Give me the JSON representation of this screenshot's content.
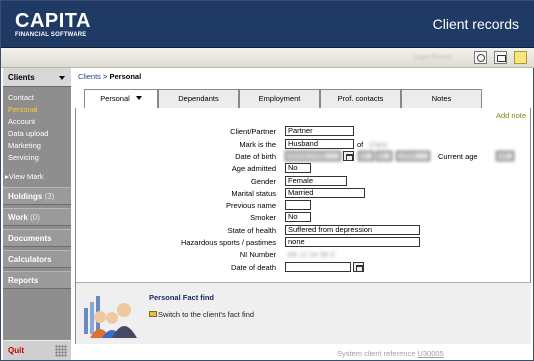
{
  "brand": {
    "name": "CAPITA",
    "sub": "FINANCIAL SOFTWARE"
  },
  "app_title": "Client records",
  "toolbar": {
    "user_text": "Gaye Brown",
    "icons": [
      "search-icon",
      "grid-icon",
      "notes-icon"
    ]
  },
  "sidebar": {
    "header": "Clients",
    "subitems": [
      "Contact",
      "Personal",
      "Account",
      "Data upload",
      "Marketing",
      "Servicing"
    ],
    "active_subitem": "Personal",
    "view_mark": "▸View Mark",
    "sections": [
      {
        "label": "Holdings",
        "count": "(3)"
      },
      {
        "label": "Work",
        "count": "(0)"
      },
      {
        "label": "Documents",
        "count": ""
      },
      {
        "label": "Calculators",
        "count": ""
      },
      {
        "label": "Reports",
        "count": ""
      }
    ],
    "quit": "Quit"
  },
  "breadcrumb": {
    "link": "Clients",
    "sep": " > ",
    "current": "Personal"
  },
  "tabs": [
    "Personal",
    "Dependants",
    "Employment",
    "Prof. contacts",
    "Notes"
  ],
  "add_note": "Add note",
  "form": {
    "client_partner": {
      "label": "Client/Partner",
      "value": "Partner"
    },
    "mark_is_the": {
      "label": "Mark is the",
      "value": "Husband",
      "of": "of",
      "of_value": "Clara"
    },
    "date_of_birth": {
      "label": "Date of birth",
      "value": "09/09/1958",
      "day": "9",
      "month": "9",
      "year": "1958",
      "current_age_label": "Current age",
      "current_age": "60"
    },
    "age_admitted": {
      "label": "Age admitted",
      "value": "No"
    },
    "gender": {
      "label": "Gender",
      "value": "Female"
    },
    "marital_status": {
      "label": "Marital status",
      "value": "Married"
    },
    "previous_name": {
      "label": "Previous name",
      "value": ""
    },
    "smoker": {
      "label": "Smoker",
      "value": "No"
    },
    "state_of_health": {
      "label": "State of health",
      "value": "Suffered from depression"
    },
    "hazardous": {
      "label": "Hazardous sports / pastimes",
      "value": "none"
    },
    "ni_number": {
      "label": "NI Number",
      "value": "AB 12 34 56 C"
    },
    "date_of_death": {
      "label": "Date of death",
      "value": ""
    }
  },
  "fact_find": {
    "title": "Personal Fact find",
    "link": "Switch to the client's fact find"
  },
  "system_ref": {
    "label": "System client reference",
    "value": "U30005"
  }
}
